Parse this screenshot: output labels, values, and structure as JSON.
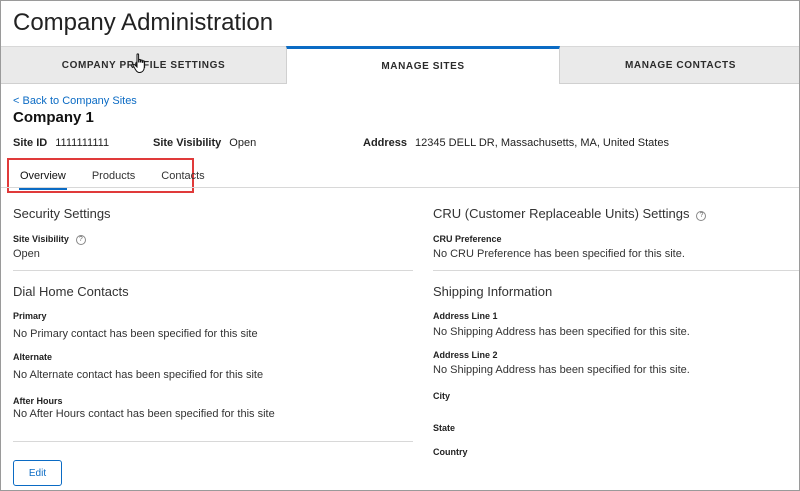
{
  "page": {
    "title": "Company Administration"
  },
  "tabs": [
    {
      "label": "COMPANY PROFILE SETTINGS"
    },
    {
      "label": "MANAGE SITES",
      "active": true
    },
    {
      "label": "MANAGE CONTACTS"
    }
  ],
  "back_link": "< Back to Company Sites",
  "company": {
    "name": "Company 1"
  },
  "meta": {
    "site_id_label": "Site ID",
    "site_id_value": "1111111111",
    "visibility_label": "Site Visibility",
    "visibility_value": "Open",
    "address_label": "Address",
    "address_value": "12345 DELL DR, Massachusetts, MA, United States"
  },
  "subtabs": [
    {
      "label": "Overview",
      "active": true
    },
    {
      "label": "Products"
    },
    {
      "label": "Contacts"
    }
  ],
  "security": {
    "title": "Security Settings",
    "visibility_label": "Site Visibility",
    "visibility_value": "Open"
  },
  "cru": {
    "title": "CRU (Customer Replaceable Units) Settings",
    "pref_label": "CRU Preference",
    "pref_value": "No CRU Preference has been specified for this site."
  },
  "dial_home": {
    "title": "Dial Home Contacts",
    "primary_label": "Primary",
    "primary_value": "No Primary contact has been specified for this site",
    "alternate_label": "Alternate",
    "alternate_value": "No Alternate contact has been specified for this site",
    "after_hours_label": "After Hours",
    "after_hours_value": "No After Hours contact has been specified for this site"
  },
  "shipping": {
    "title": "Shipping Information",
    "addr1_label": "Address Line 1",
    "addr1_value": "No Shipping Address has been specified for this site.",
    "addr2_label": "Address Line 2",
    "addr2_value": "No Shipping Address has been specified for this site.",
    "city_label": "City",
    "state_label": "State",
    "country_label": "Country"
  },
  "actions": {
    "edit_label": "Edit"
  },
  "colors": {
    "accent": "#0b6bc4",
    "highlight_box": "#e03a3a",
    "tabbar_bg": "#eaeaea"
  }
}
